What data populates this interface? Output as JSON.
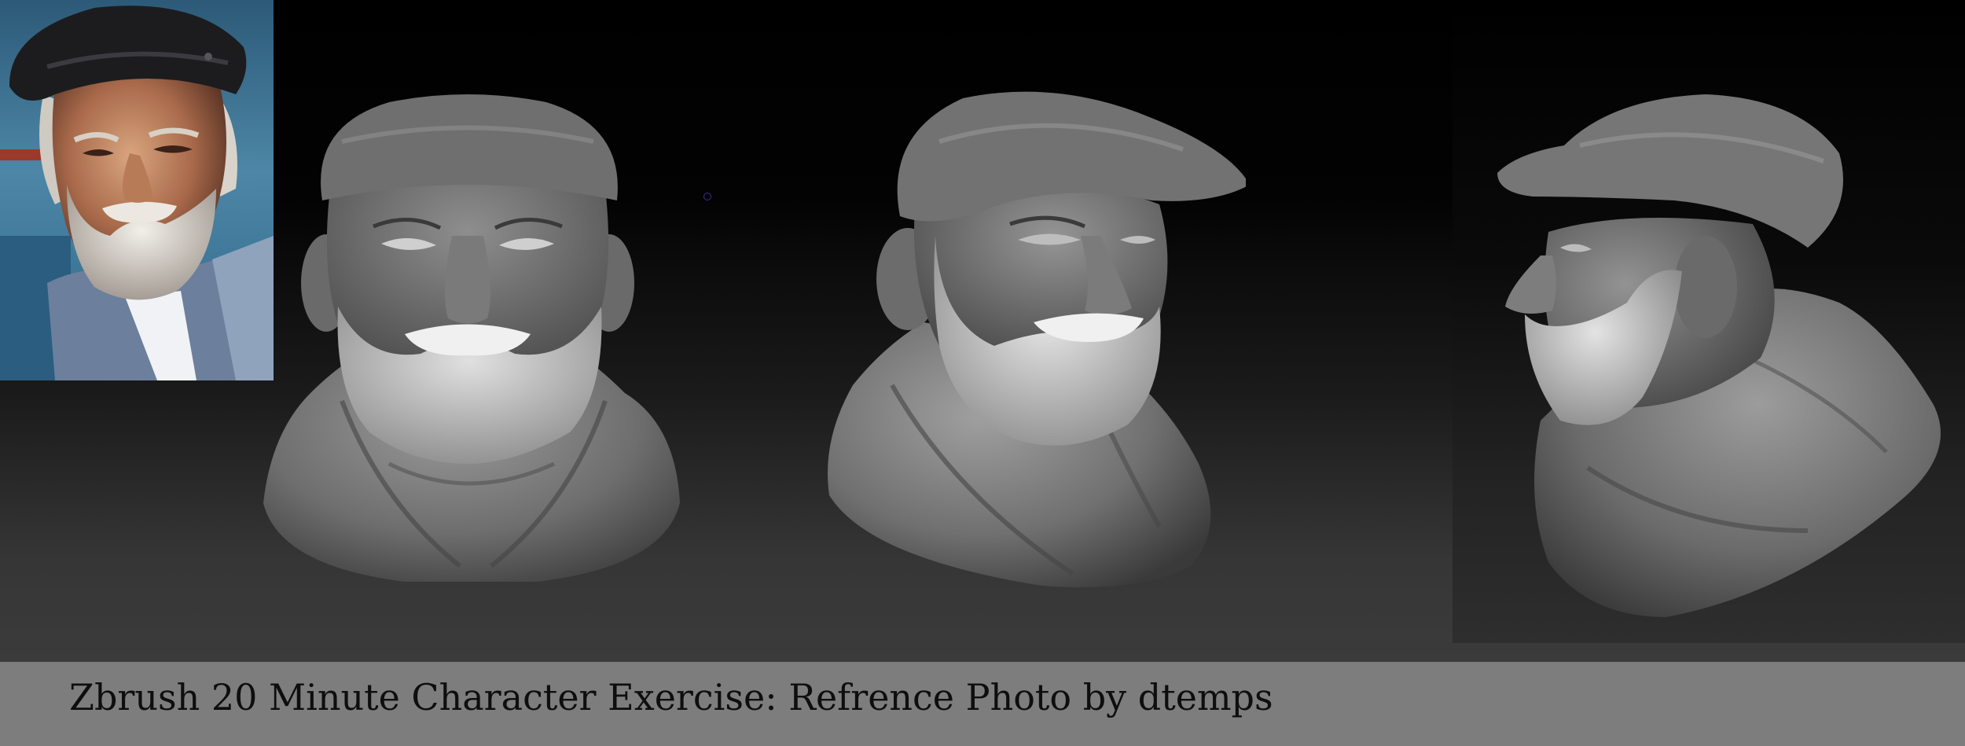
{
  "caption": {
    "text": "Zbrush 20 Minute Character Exercise: Refrence Photo by dtemps"
  },
  "colors": {
    "caption_bar": "#7d7d7d",
    "caption_text": "#0e0e0e",
    "viewport_top": "#000000",
    "viewport_bottom": "#3b3b3b",
    "clay": "#8a8a8a"
  }
}
